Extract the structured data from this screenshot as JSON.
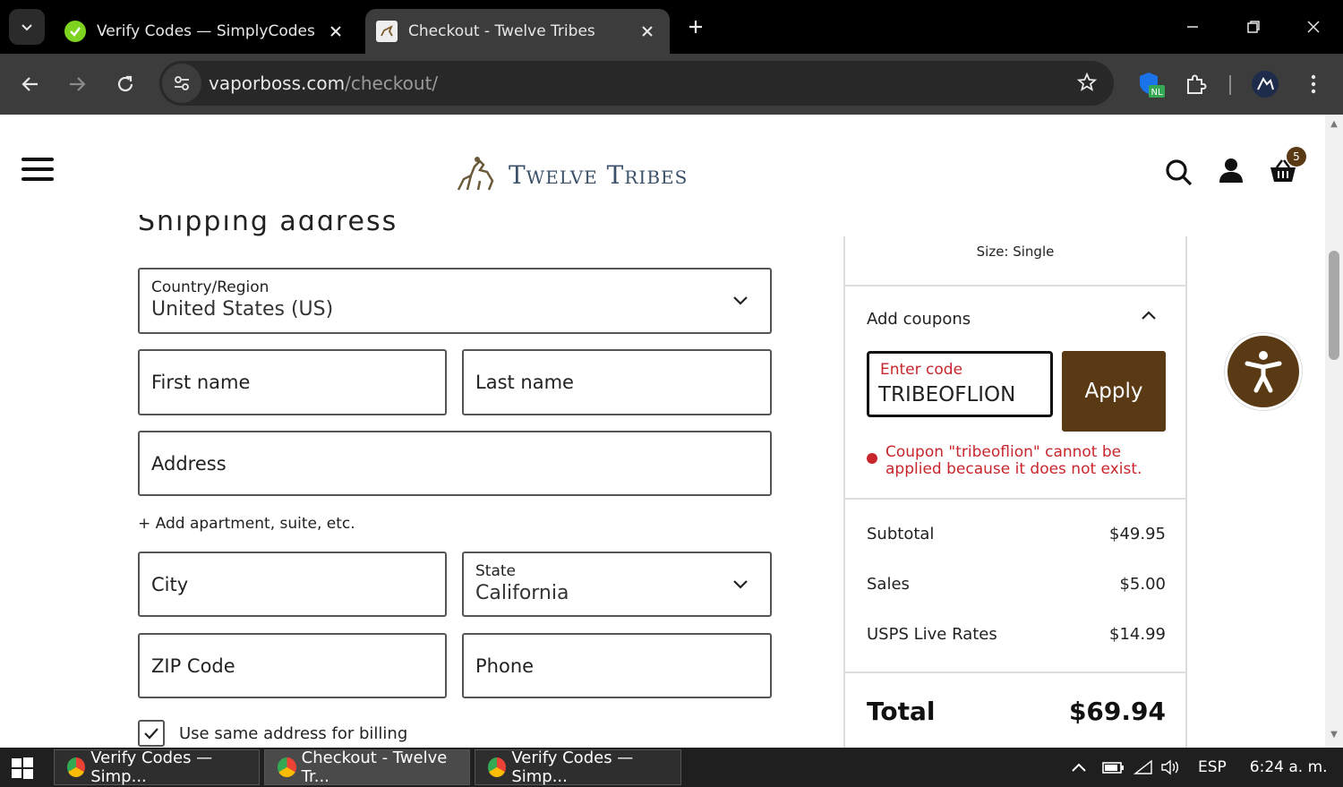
{
  "browser": {
    "tabs": [
      {
        "title": "Verify Codes — SimplyCodes",
        "active": false
      },
      {
        "title": "Checkout - Twelve Tribes",
        "active": true
      }
    ],
    "url_domain": "vaporboss.com",
    "url_path": "/checkout/",
    "extension_badge": "NL"
  },
  "header": {
    "logo_text": "Twelve Tribes",
    "cart_count": "5"
  },
  "shipping": {
    "heading": "Shipping address",
    "country_label": "Country/Region",
    "country_value": "United States (US)",
    "first_name_placeholder": "First name",
    "last_name_placeholder": "Last name",
    "address_placeholder": "Address",
    "add_apartment": "+ Add apartment, suite, etc.",
    "city_placeholder": "City",
    "state_label": "State",
    "state_value": "California",
    "zip_placeholder": "ZIP Code",
    "phone_placeholder": "Phone",
    "billing_checkbox_label": "Use same address for billing",
    "billing_checked": true
  },
  "summary": {
    "size_text": "Size: Single",
    "coupons_title": "Add coupons",
    "coupon_label": "Enter code",
    "coupon_value": "TRIBEOFLION",
    "apply_label": "Apply",
    "coupon_error": "Coupon \"tribeoflion\" cannot be applied because it does not exist.",
    "subtotal_label": "Subtotal",
    "subtotal_value": "$49.95",
    "sales_label": "Sales",
    "sales_value": "$5.00",
    "shipping_label": "USPS Live Rates",
    "shipping_value": "$14.99",
    "total_label": "Total",
    "total_value": "$69.94"
  },
  "taskbar": {
    "tasks": [
      {
        "title": "Verify Codes — Simp..."
      },
      {
        "title": "Checkout - Twelve Tr..."
      },
      {
        "title": "Verify Codes — Simp..."
      }
    ],
    "language": "ESP",
    "time": "6:24 a. m."
  },
  "colors": {
    "brand_brown": "#5a3a14",
    "error_red": "#c8262c",
    "logo_blue": "#3b5169"
  }
}
